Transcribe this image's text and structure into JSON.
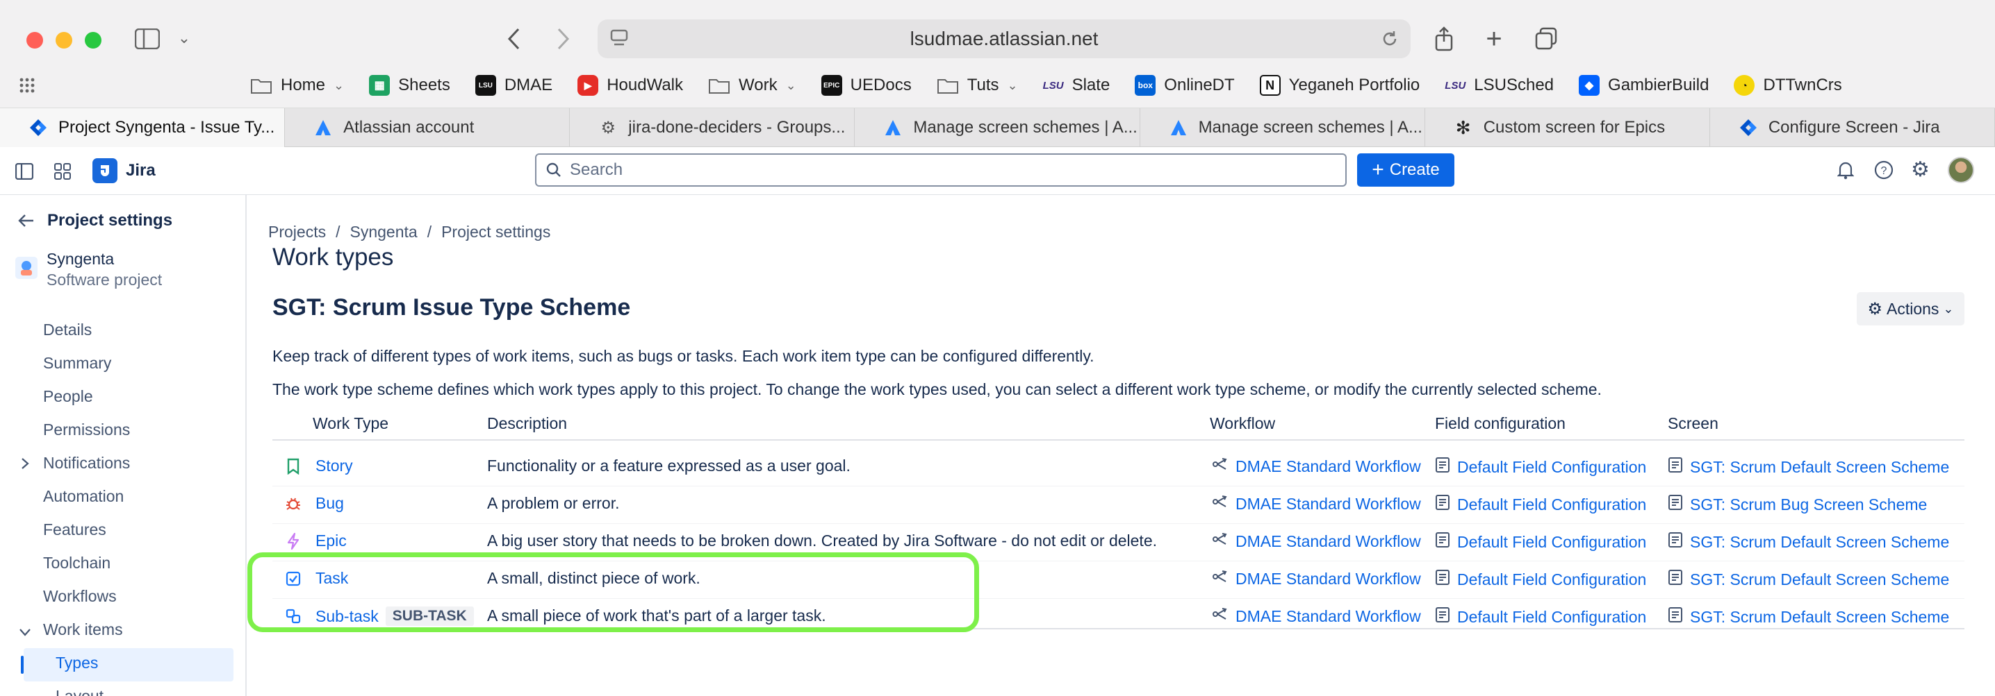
{
  "browser": {
    "url": "lsudmae.atlassian.net",
    "bookmarks": [
      {
        "label": "Home",
        "icon": "folder-icon",
        "menu": true
      },
      {
        "label": "Sheets",
        "icon": "sheets-icon"
      },
      {
        "label": "DMAE",
        "icon": "dmae-icon"
      },
      {
        "label": "HoudWalk",
        "icon": "youtube-icon"
      },
      {
        "label": "Work",
        "icon": "folder-icon",
        "menu": true
      },
      {
        "label": "UEDocs",
        "icon": "epic-icon"
      },
      {
        "label": "Tuts",
        "icon": "folder-icon",
        "menu": true
      },
      {
        "label": "Slate",
        "icon": "lsu-icon"
      },
      {
        "label": "OnlineDT",
        "icon": "box-icon"
      },
      {
        "label": "Yeganeh Portfolio",
        "icon": "notion-icon"
      },
      {
        "label": "LSUSched",
        "icon": "lsu-icon"
      },
      {
        "label": "GambierBuild",
        "icon": "dropbox-icon"
      },
      {
        "label": "DTTwnCrs",
        "icon": "gauge-icon"
      }
    ],
    "tabs": [
      {
        "label": "Project Syngenta - Issue Ty...",
        "icon": "jira-icon",
        "active": true
      },
      {
        "label": "Atlassian account",
        "icon": "atlassian-icon"
      },
      {
        "label": "jira-done-deciders - Groups...",
        "icon": "gear-icon"
      },
      {
        "label": "Manage screen schemes | A...",
        "icon": "atlassian-icon"
      },
      {
        "label": "Manage screen schemes | A...",
        "icon": "atlassian-icon"
      },
      {
        "label": "Custom screen for Epics",
        "icon": "openai-icon"
      },
      {
        "label": "Configure Screen - Jira",
        "icon": "jira-icon"
      }
    ]
  },
  "jira": {
    "app_name": "Jira",
    "search_placeholder": "Search",
    "create_label": "Create"
  },
  "sidebar": {
    "back_title": "Project settings",
    "project_name": "Syngenta",
    "project_type": "Software project",
    "items": [
      {
        "label": "Details"
      },
      {
        "label": "Summary"
      },
      {
        "label": "People"
      },
      {
        "label": "Permissions"
      },
      {
        "label": "Notifications"
      },
      {
        "label": "Automation"
      },
      {
        "label": "Features"
      },
      {
        "label": "Toolchain"
      },
      {
        "label": "Workflows"
      },
      {
        "label": "Work items"
      },
      {
        "label": "Types"
      },
      {
        "label": "Layout"
      }
    ]
  },
  "page": {
    "breadcrumb": [
      "Projects",
      "Syngenta",
      "Project settings"
    ],
    "title": "Work types",
    "scheme_title": "SGT: Scrum Issue Type Scheme",
    "actions_label": "Actions",
    "desc1": "Keep track of different types of work items, such as bugs or tasks. Each work item type can be configured differently.",
    "desc2": "The work type scheme defines which work types apply to this project. To change the work types used, you can select a different work type scheme, or modify the currently selected scheme."
  },
  "table": {
    "headers": [
      "Work Type",
      "Description",
      "Workflow",
      "Field configuration",
      "Screen"
    ],
    "rows": [
      {
        "type": "Story",
        "icon": "bookmark-icon",
        "icon_color": "#22a06b",
        "badge": "",
        "description": "Functionality or a feature expressed as a user goal.",
        "workflow": "DMAE Standard Workflow",
        "field_config": "Default Field Configuration",
        "screen": "SGT: Scrum Default Screen Scheme"
      },
      {
        "type": "Bug",
        "icon": "bug-icon",
        "icon_color": "#e34935",
        "badge": "",
        "description": "A problem or error.",
        "workflow": "DMAE Standard Workflow",
        "field_config": "Default Field Configuration",
        "screen": "SGT: Scrum Bug Screen Scheme"
      },
      {
        "type": "Epic",
        "icon": "lightning-icon",
        "icon_color": "#c97cf4",
        "badge": "",
        "description": "A big user story that needs to be broken down. Created by Jira Software - do not edit or delete.",
        "workflow": "DMAE Standard Workflow",
        "field_config": "Default Field Configuration",
        "screen": "SGT: Scrum Default Screen Scheme"
      },
      {
        "type": "Task",
        "icon": "checkbox-icon",
        "icon_color": "#1d7afc",
        "badge": "",
        "description": "A small, distinct piece of work.",
        "workflow": "DMAE Standard Workflow",
        "field_config": "Default Field Configuration",
        "screen": "SGT: Scrum Default Screen Scheme"
      },
      {
        "type": "Sub-task",
        "icon": "subtask-icon",
        "icon_color": "#1d7afc",
        "badge": "SUB-TASK",
        "description": "A small piece of work that's part of a larger task.",
        "workflow": "DMAE Standard Workflow",
        "field_config": "Default Field Configuration",
        "screen": "SGT: Scrum Default Screen Scheme"
      }
    ]
  }
}
